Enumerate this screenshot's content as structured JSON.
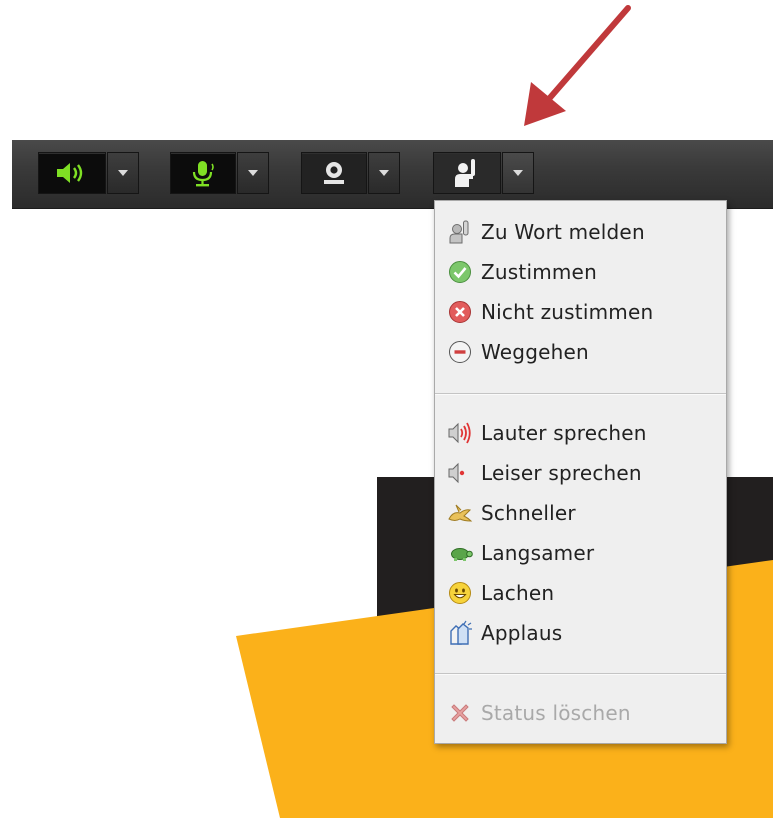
{
  "colors": {
    "annotation_arrow": "#c0393b",
    "toolbar_bg": "#333333",
    "active_icon": "#7fe024",
    "menu_bg": "#efefef",
    "disabled_text": "#a9a9a9",
    "background_yellow": "#fbb11a",
    "background_dark": "#221f1f"
  },
  "toolbar": {
    "buttons": [
      {
        "name": "speaker",
        "icon": "speaker-icon",
        "active": true
      },
      {
        "name": "microphone",
        "icon": "microphone-icon",
        "active": true
      },
      {
        "name": "camera",
        "icon": "webcam-icon",
        "active": false
      },
      {
        "name": "status",
        "icon": "raise-hand-icon",
        "active": false,
        "menu_open": true
      }
    ]
  },
  "status_menu": {
    "group1": [
      {
        "label": "Zu Wort melden",
        "icon": "raise-hand-icon"
      },
      {
        "label": "Zustimmen",
        "icon": "check-icon"
      },
      {
        "label": "Nicht zustimmen",
        "icon": "x-circle-icon"
      },
      {
        "label": "Weggehen",
        "icon": "minus-circle-icon"
      }
    ],
    "group2": [
      {
        "label": "Lauter sprechen",
        "icon": "speaker-louder-icon"
      },
      {
        "label": "Leiser sprechen",
        "icon": "speaker-quieter-icon"
      },
      {
        "label": "Schneller",
        "icon": "rabbit-icon"
      },
      {
        "label": "Langsamer",
        "icon": "turtle-icon"
      },
      {
        "label": "Lachen",
        "icon": "smiley-icon"
      },
      {
        "label": "Applaus",
        "icon": "applause-icon"
      }
    ],
    "clear": {
      "label": "Status löschen",
      "icon": "clear-x-icon",
      "disabled": true
    }
  }
}
